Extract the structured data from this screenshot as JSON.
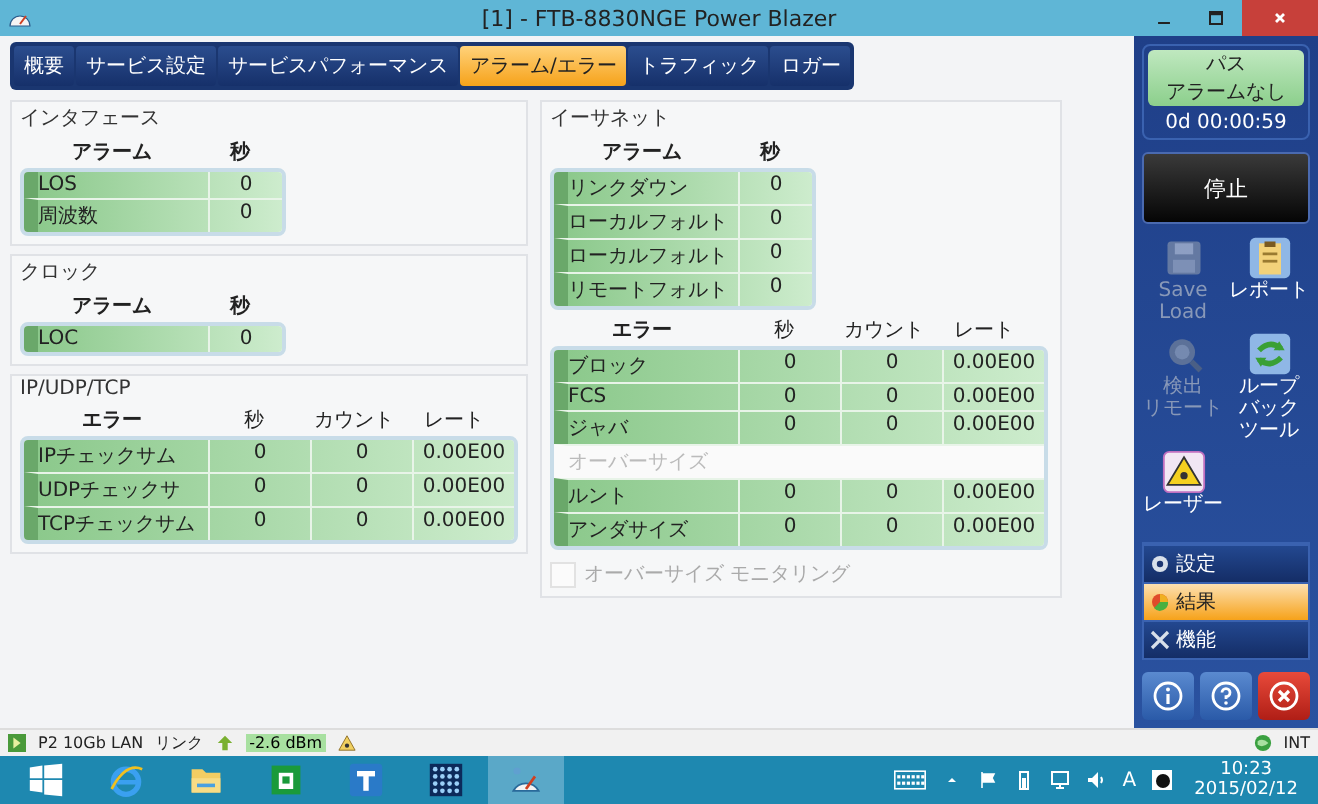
{
  "window": {
    "title": "[1] - FTB-8830NGE Power Blazer"
  },
  "tabs": [
    {
      "label": "概要",
      "selected": false
    },
    {
      "label": "サービス設定",
      "selected": false
    },
    {
      "label": "サービスパフォーマンス",
      "selected": false
    },
    {
      "label": "アラーム/エラー",
      "selected": true
    },
    {
      "label": "トラフィック",
      "selected": false
    },
    {
      "label": "ロガー",
      "selected": false
    }
  ],
  "interface": {
    "title": "インタフェース",
    "columns": [
      "アラーム",
      "秒"
    ],
    "rows": [
      {
        "cells": [
          "LOS",
          "0"
        ]
      },
      {
        "cells": [
          "周波数",
          "0"
        ]
      }
    ]
  },
  "clock": {
    "title": "クロック",
    "columns": [
      "アラーム",
      "秒"
    ],
    "rows": [
      {
        "cells": [
          "LOC",
          "0"
        ]
      }
    ]
  },
  "ip_udp_tcp": {
    "title": "IP/UDP/TCP",
    "columns": [
      "エラー",
      "秒",
      "カウント",
      "レート"
    ],
    "rows": [
      {
        "cells": [
          "IPチェックサム",
          "0",
          "0",
          "0.00E00"
        ]
      },
      {
        "cells": [
          "UDPチェックサ",
          "0",
          "0",
          "0.00E00"
        ]
      },
      {
        "cells": [
          "TCPチェックサム",
          "0",
          "0",
          "0.00E00"
        ]
      }
    ]
  },
  "ethernet": {
    "title": "イーサネット",
    "alarm_columns": [
      "アラーム",
      "秒"
    ],
    "alarm_rows": [
      {
        "cells": [
          "リンクダウン",
          "0"
        ]
      },
      {
        "cells": [
          "ローカルフォルト",
          "0"
        ]
      },
      {
        "cells": [
          "ローカルフォルト",
          "0"
        ]
      },
      {
        "cells": [
          "リモートフォルト",
          "0"
        ]
      }
    ],
    "error_columns": [
      "エラー",
      "秒",
      "カウント",
      "レート"
    ],
    "error_rows": [
      {
        "disabled": false,
        "cells": [
          "ブロック",
          "0",
          "0",
          "0.00E00"
        ]
      },
      {
        "disabled": false,
        "cells": [
          "FCS",
          "0",
          "0",
          "0.00E00"
        ]
      },
      {
        "disabled": false,
        "cells": [
          "ジャバ",
          "0",
          "0",
          "0.00E00"
        ]
      },
      {
        "disabled": true,
        "cells": [
          "オーバーサイズ"
        ]
      },
      {
        "disabled": false,
        "cells": [
          "ルント",
          "0",
          "0",
          "0.00E00"
        ]
      },
      {
        "disabled": false,
        "cells": [
          "アンダサイズ",
          "0",
          "0",
          "0.00E00"
        ]
      }
    ],
    "oversize_monitoring": {
      "label": "オーバーサイズ モニタリング",
      "checked": false,
      "disabled": true
    }
  },
  "sidebar": {
    "status": {
      "title": "パス",
      "alarm": "アラームなし",
      "elapsed": "0d 00:00:59"
    },
    "stop_button": "停止",
    "tools": [
      {
        "kind": "save",
        "lines": [
          "Save",
          "Load"
        ],
        "disabled": true
      },
      {
        "kind": "report",
        "lines": [
          "レポート"
        ],
        "disabled": false
      },
      {
        "kind": "detect",
        "lines": [
          "検出",
          "リモート"
        ],
        "disabled": true
      },
      {
        "kind": "loopback",
        "lines": [
          "ループ",
          "バック",
          "ツール"
        ],
        "disabled": false
      },
      {
        "kind": "laser",
        "lines": [
          "レーザー"
        ],
        "disabled": false
      }
    ],
    "nav": [
      {
        "kind": "settings",
        "label": "設定",
        "selected": false
      },
      {
        "kind": "results",
        "label": "結果",
        "selected": true
      },
      {
        "kind": "functions",
        "label": "機能",
        "selected": false
      }
    ]
  },
  "status_bar": {
    "port": "P2 10Gb LAN",
    "link": "リンク",
    "power": "-2.6 dBm",
    "clock_source": "INT"
  },
  "taskbar": {
    "apps": [
      {
        "kind": "start",
        "selected": false
      },
      {
        "kind": "ie",
        "selected": false
      },
      {
        "kind": "folder",
        "selected": false
      },
      {
        "kind": "store",
        "selected": false
      },
      {
        "kind": "t",
        "selected": false
      },
      {
        "kind": "dots",
        "selected": false
      },
      {
        "kind": "app",
        "selected": true
      }
    ],
    "ime": "A",
    "time": "10:23",
    "date": "2015/02/12"
  }
}
